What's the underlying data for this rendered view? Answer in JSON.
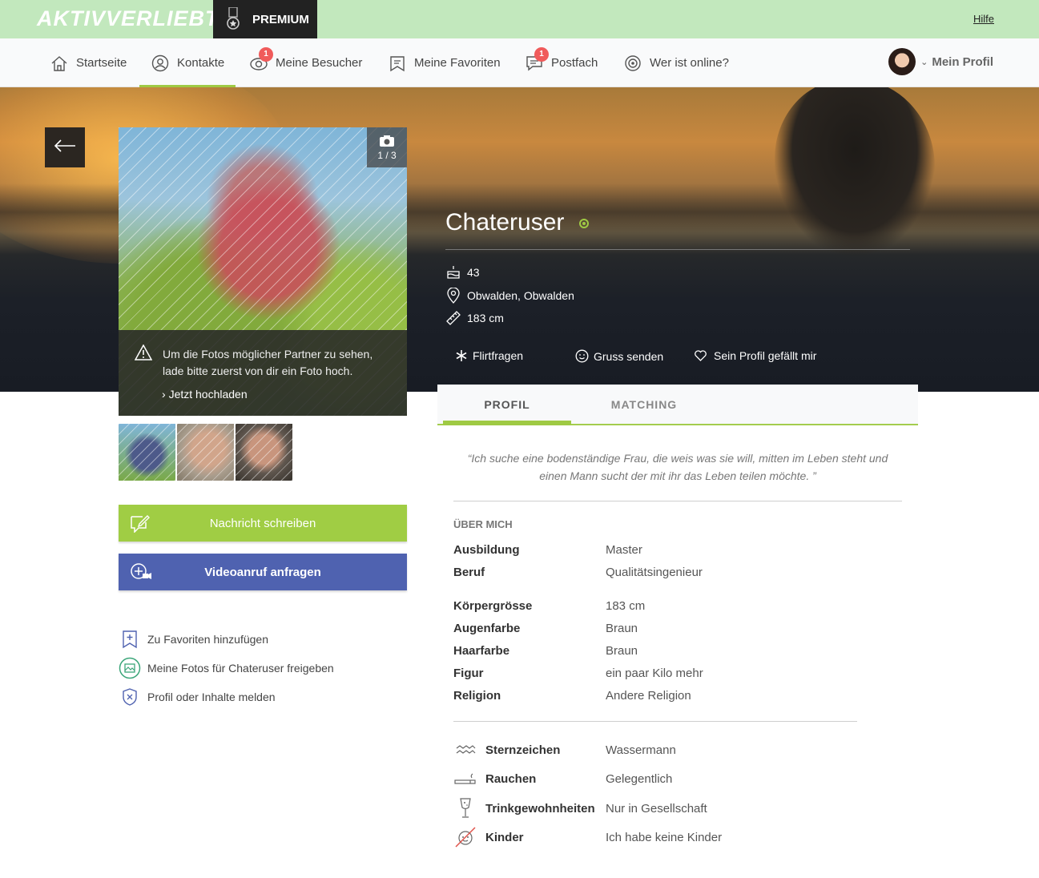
{
  "brand": {
    "logo_text": "AKTIVVERLIEBT",
    "premium_label": "PREMIUM",
    "help_link": "Hilfe"
  },
  "nav": {
    "items": [
      {
        "label": "Startseite",
        "icon": "home-icon"
      },
      {
        "label": "Kontakte",
        "icon": "contacts-icon",
        "active": true
      },
      {
        "label": "Meine Besucher",
        "icon": "eye-icon",
        "badge": "1"
      },
      {
        "label": "Meine Favoriten",
        "icon": "bookmark-icon"
      },
      {
        "label": "Postfach",
        "icon": "mail-chat-icon",
        "badge": "1"
      },
      {
        "label": "Wer ist online?",
        "icon": "online-icon"
      }
    ],
    "profile_label": "Mein Profil"
  },
  "photo": {
    "counter": "1 / 3",
    "notice_text": "Um die Fotos möglicher Partner zu sehen, lade bitte zuerst von dir ein Foto hoch.",
    "upload_link": "Jetzt hochladen"
  },
  "buttons": {
    "message": "Nachricht schreiben",
    "video": "Videoanruf anfragen"
  },
  "side_links": [
    {
      "label": "Zu Favoriten hinzufügen",
      "icon": "bookmark-add-icon"
    },
    {
      "label": "Meine Fotos für Chateruser freigeben",
      "icon": "photo-share-icon"
    },
    {
      "label": "Profil oder Inhalte melden",
      "icon": "report-shield-icon"
    }
  ],
  "profile": {
    "username": "Chateruser",
    "age": "43",
    "location": "Obwalden, Obwalden",
    "height": "183 cm",
    "actions": {
      "flirt": "Flirtfragen",
      "greet": "Gruss senden",
      "like": "Sein Profil gefällt mir"
    }
  },
  "tabs": {
    "profile": "PROFIL",
    "matching": "MATCHING"
  },
  "quote": "“Ich suche eine bodenständige Frau, die weis was sie will, mitten im Leben steht und einen Mann sucht der mit ihr das Leben teilen möchte. ”",
  "about": {
    "title": "ÜBER MICH",
    "rows1": [
      {
        "k": "Ausbildung",
        "v": "Master"
      },
      {
        "k": "Beruf",
        "v": "Qualitätsingenieur"
      }
    ],
    "rows2": [
      {
        "k": "Körpergrösse",
        "v": "183 cm"
      },
      {
        "k": "Augenfarbe",
        "v": "Braun"
      },
      {
        "k": "Haarfarbe",
        "v": "Braun"
      },
      {
        "k": "Figur",
        "v": "ein paar Kilo mehr"
      },
      {
        "k": "Religion",
        "v": "Andere Religion"
      }
    ],
    "rows3": [
      {
        "k": "Sternzeichen",
        "v": "Wassermann",
        "icon": "aquarius-icon"
      },
      {
        "k": "Rauchen",
        "v": "Gelegentlich",
        "icon": "cigarette-icon"
      },
      {
        "k": "Trinkgewohnheiten",
        "v": "Nur in Gesellschaft",
        "icon": "glass-icon"
      },
      {
        "k": "Kinder",
        "v": "Ich habe keine Kinder",
        "icon": "no-children-icon"
      }
    ]
  },
  "colors": {
    "green": "#9fca44",
    "blue": "#4f62b0",
    "topbar": "#c2e8bd",
    "badge": "#f05b5b"
  }
}
